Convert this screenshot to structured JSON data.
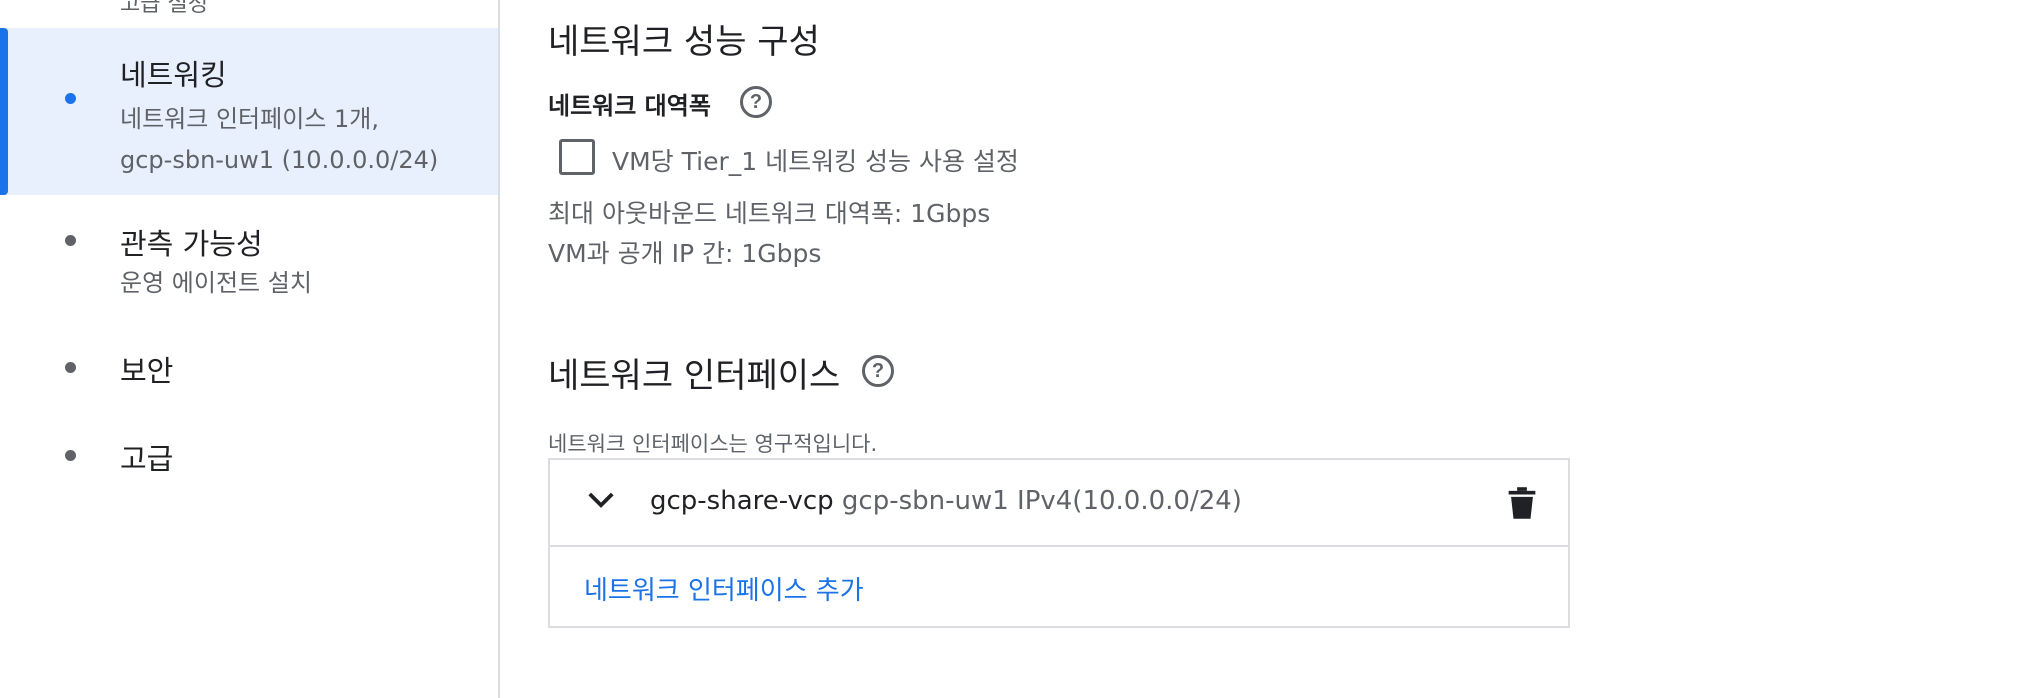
{
  "sidebar": {
    "top_clipped_text": "고급 설정",
    "items": [
      {
        "title": "네트워킹",
        "sub": [
          "네트워크 인터페이스 1개,",
          "gcp-sbn-uw1 (10.0.0.0/24)"
        ],
        "active": true
      },
      {
        "title": "관측 가능성",
        "sub": [
          "운영 에이전트 설치"
        ],
        "active": false
      },
      {
        "title": "보안",
        "sub": [],
        "active": false
      },
      {
        "title": "고급",
        "sub": [],
        "active": false
      }
    ]
  },
  "main": {
    "perf_title": "네트워크 성능 구성",
    "bandwidth_label": "네트워크 대역폭",
    "help_glyph": "?",
    "tier1_checkbox_label": "VM당 Tier_1 네트워킹 성능 사용 설정",
    "tier1_checked": false,
    "max_outbound": "최대 아웃바운드 네트워크 대역폭: 1Gbps",
    "vm_public_ip": "VM과 공개 IP 간: 1Gbps",
    "iface_title": "네트워크 인터페이스",
    "iface_note": "네트워크 인터페이스는 영구적입니다.",
    "interfaces": [
      {
        "name": "gcp-share-vcp",
        "detail": "gcp-sbn-uw1 IPv4(10.0.0.0/24)"
      }
    ],
    "add_iface_label": "네트워크 인터페이스 추가"
  },
  "colors": {
    "accent": "#1a73e8",
    "active_bg": "#e8f0fe",
    "border": "#dadce0",
    "secondary_text": "#5f6368"
  },
  "icons": {
    "help": "help-circle-icon",
    "expand": "chevron-down-icon",
    "delete": "trash-icon"
  }
}
